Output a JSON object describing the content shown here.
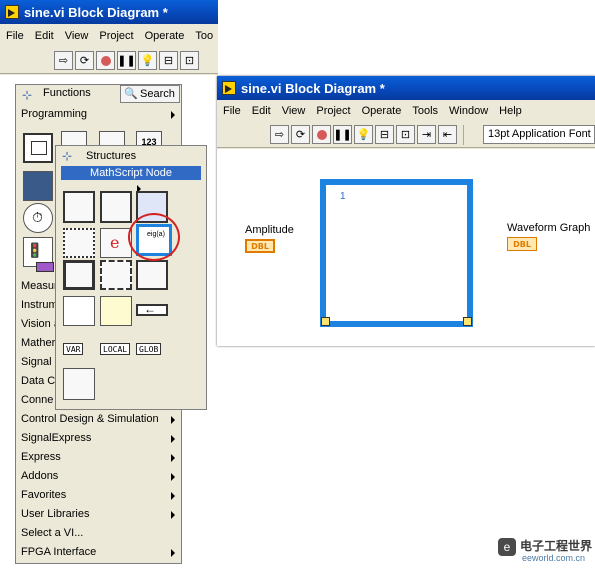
{
  "back_window": {
    "title": "sine.vi Block Diagram *",
    "menu": [
      "File",
      "Edit",
      "View",
      "Project",
      "Operate",
      "Too"
    ]
  },
  "functions_palette": {
    "title": "Functions",
    "search_label": "Search",
    "category": "Programming",
    "items": [
      "Measur",
      "Instrum",
      "Vision a",
      "Mather",
      "Signal",
      "Data C",
      "Conne",
      "Control Design & Simulation",
      "SignalExpress",
      "Express",
      "Addons",
      "Favorites",
      "User Libraries",
      "Select a VI...",
      "FPGA Interface"
    ],
    "tile_label": "123"
  },
  "structures_palette": {
    "title": "Structures",
    "highlight": "MathScript Node",
    "tags": [
      "VAR",
      "LOCAL",
      "GLOB"
    ],
    "tile_label": "e"
  },
  "front_window": {
    "title": "sine.vi Block Diagram *",
    "menu": [
      "File",
      "Edit",
      "View",
      "Project",
      "Operate",
      "Tools",
      "Window",
      "Help"
    ],
    "font_select": "13pt Application Font",
    "node_line": "1",
    "amplitude_label": "Amplitude",
    "waveform_label": "Waveform Graph",
    "terminal_type": "DBL"
  },
  "watermark": {
    "brand": "电子工程世界",
    "site": "eeworld.com.cn"
  },
  "colors": {
    "title_bar": "#0747b8",
    "node_border": "#1c84e0",
    "highlight_circle": "#d42222",
    "terminal": "#e07b00"
  }
}
